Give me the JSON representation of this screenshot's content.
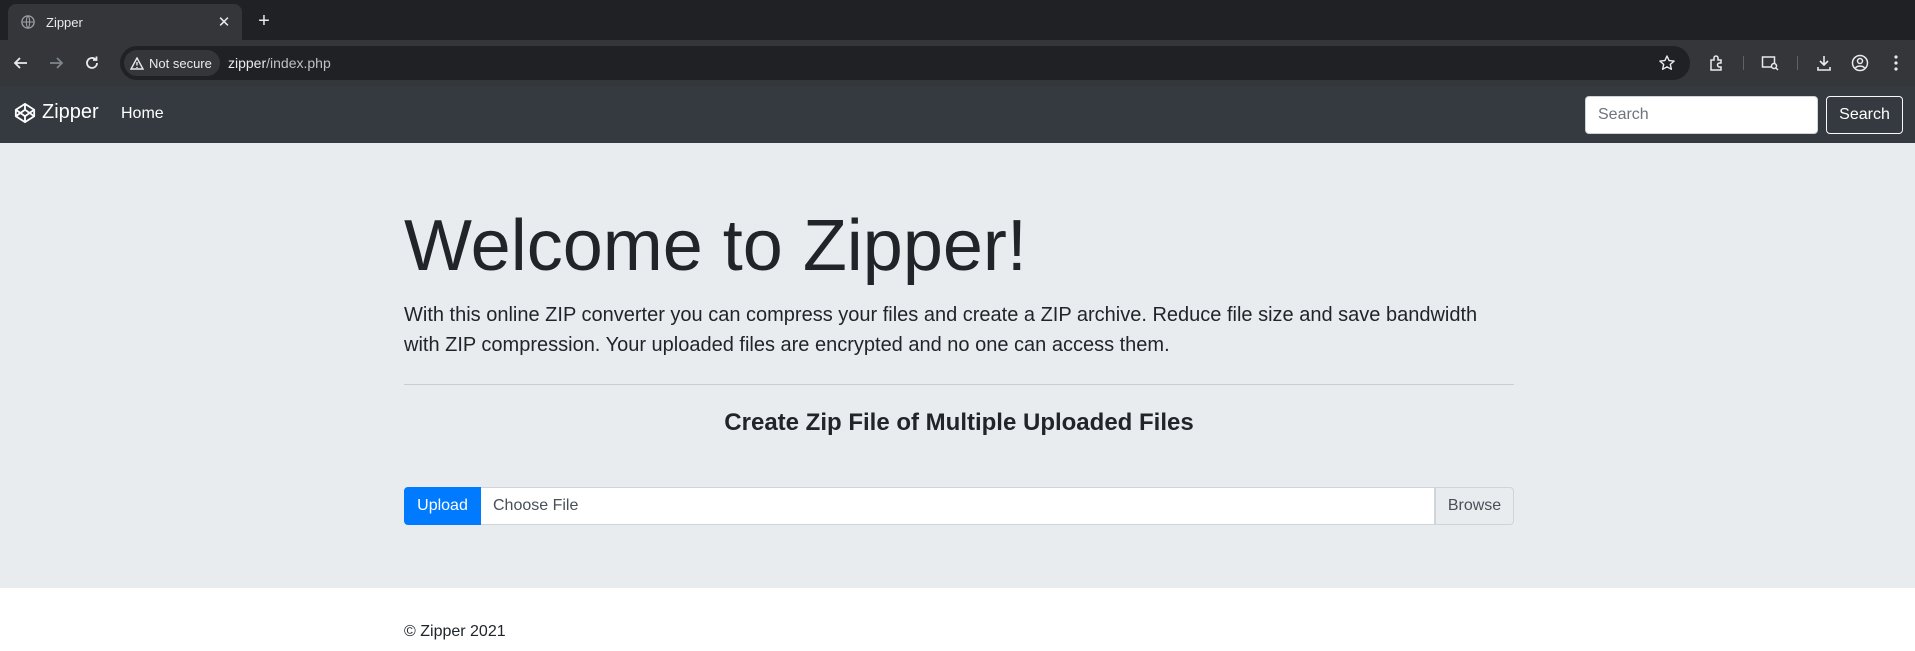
{
  "browser": {
    "tab_title": "Zipper",
    "tab_close_glyph": "✕",
    "new_tab_glyph": "+",
    "security_label": "Not secure",
    "url_host": "zipper",
    "url_path": "/index.php",
    "icons": [
      "globe-icon",
      "close-icon",
      "plus-icon",
      "back-arrow-icon",
      "forward-arrow-icon",
      "reload-icon",
      "warning-icon",
      "star-icon",
      "extensions-icon",
      "tab-search-icon",
      "download-icon",
      "profile-icon",
      "kebab-menu-icon"
    ]
  },
  "navbar": {
    "brand": "Zipper",
    "home_link": "Home",
    "search_placeholder": "Search",
    "search_button": "Search",
    "brand_icon": "codepen-icon",
    "background": "#343a40"
  },
  "hero": {
    "heading": "Welcome to Zipper!",
    "lead": "With this online ZIP converter you can compress your files and create a ZIP archive. Reduce file size and save bandwidth with ZIP compression. Your uploaded files are encrypted and no one can access them.",
    "subheading": "Create Zip File of Multiple Uploaded Files",
    "upload_button": "Upload",
    "file_label": "Choose File",
    "browse_label": "Browse",
    "accent": "#007bff",
    "background": "#e9ecef"
  },
  "footer": {
    "text": "© Zipper 2021"
  }
}
